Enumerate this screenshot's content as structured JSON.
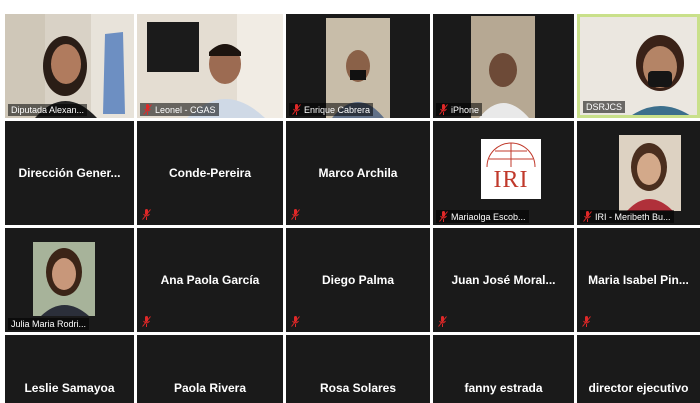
{
  "participants": [
    {
      "name": "Diputada Alexan...",
      "video": true,
      "muted": false
    },
    {
      "name": "Leonel - CGAS",
      "video": true,
      "muted": true
    },
    {
      "name": "Enrique Cabrera",
      "video": true,
      "muted": true
    },
    {
      "name": "iPhone",
      "video": true,
      "muted": true
    },
    {
      "name": "DSRJCS",
      "video": true,
      "muted": false,
      "active_speaker": true
    },
    {
      "name": "Dirección Gener...",
      "video": false,
      "muted": false
    },
    {
      "name": "Conde-Pereira",
      "video": false,
      "muted": true
    },
    {
      "name": "Marco Archila",
      "video": false,
      "muted": true
    },
    {
      "name": "Mariaolga Escob...",
      "video": true,
      "muted": true,
      "logo_text": "IRI"
    },
    {
      "name": "IRI - Meribeth Bu...",
      "video": true,
      "muted": true
    },
    {
      "name": "Julia Maria Rodri...",
      "video": true,
      "muted": false
    },
    {
      "name": "Ana Paola García",
      "video": false,
      "muted": true
    },
    {
      "name": "Diego Palma",
      "video": false,
      "muted": true
    },
    {
      "name": "Juan José Moral...",
      "video": false,
      "muted": true
    },
    {
      "name": "Maria Isabel Pin...",
      "video": false,
      "muted": true
    },
    {
      "name": "Leslie Samayoa",
      "video": false,
      "muted": false
    },
    {
      "name": "Paola Rivera",
      "video": false,
      "muted": false
    },
    {
      "name": "Rosa Solares",
      "video": false,
      "muted": false
    },
    {
      "name": "fanny estrada",
      "video": false,
      "muted": false
    },
    {
      "name": "director ejecutivo",
      "video": false,
      "muted": false
    }
  ],
  "colors": {
    "tile_bg": "#1a1a1a",
    "muted_icon": "#e02828",
    "active_border": "#c9e08a"
  },
  "icons": {
    "muted": "microphone-muted-icon"
  }
}
